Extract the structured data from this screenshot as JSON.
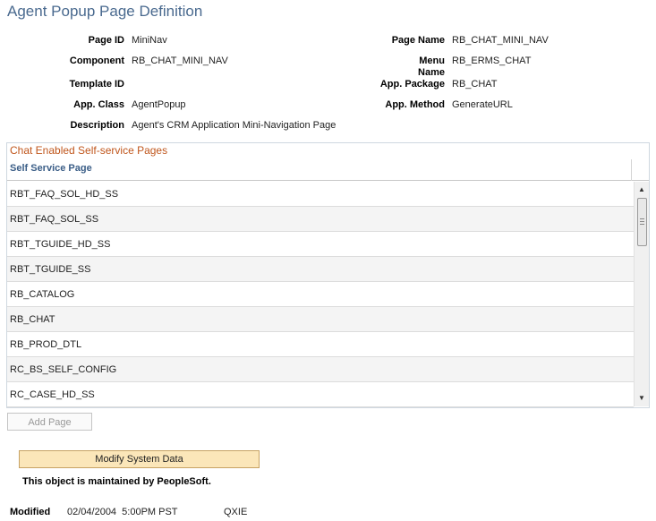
{
  "page": {
    "title": "Agent Popup Page Definition"
  },
  "fields": {
    "page_id": {
      "label": "Page ID",
      "value": "MiniNav"
    },
    "component": {
      "label": "Component",
      "value": "RB_CHAT_MINI_NAV"
    },
    "template_id": {
      "label": "Template ID",
      "value": ""
    },
    "app_class": {
      "label": "App. Class",
      "value": "AgentPopup"
    },
    "description": {
      "label": "Description",
      "value": "Agent's CRM Application Mini-Navigation Page"
    },
    "page_name": {
      "label": "Page Name",
      "value": "RB_CHAT_MINI_NAV"
    },
    "menu_name": {
      "label_line1": "Menu",
      "label_line2": "Name",
      "value": "RB_ERMS_CHAT"
    },
    "app_package": {
      "label": "App. Package",
      "value": "RB_CHAT"
    },
    "app_method": {
      "label": "App. Method",
      "value": "GenerateURL"
    }
  },
  "grid": {
    "title": "Chat Enabled Self-service Pages",
    "column_header": "Self Service Page",
    "rows": [
      "RBT_FAQ_SOL_HD_SS",
      "RBT_FAQ_SOL_SS",
      "RBT_TGUIDE_HD_SS",
      "RBT_TGUIDE_SS",
      "RB_CATALOG",
      "RB_CHAT",
      "RB_PROD_DTL",
      "RC_BS_SELF_CONFIG",
      "RC_CASE_HD_SS"
    ],
    "scroll_up_icon": "arrow-up-icon",
    "scroll_down_icon": "arrow-down-icon"
  },
  "buttons": {
    "add_page": "Add Page",
    "modify_system_data": "Modify System Data"
  },
  "footer": {
    "maintained_note": "This object is maintained by PeopleSoft.",
    "modified_label": "Modified",
    "modified_date": "02/04/2004  5:00PM PST",
    "modified_by": "QXIE"
  },
  "colors": {
    "title": "#4a6a8f",
    "grid_title": "#c0561c",
    "column_header": "#3b5e87",
    "modify_button_bg": "#fbe6b9"
  }
}
